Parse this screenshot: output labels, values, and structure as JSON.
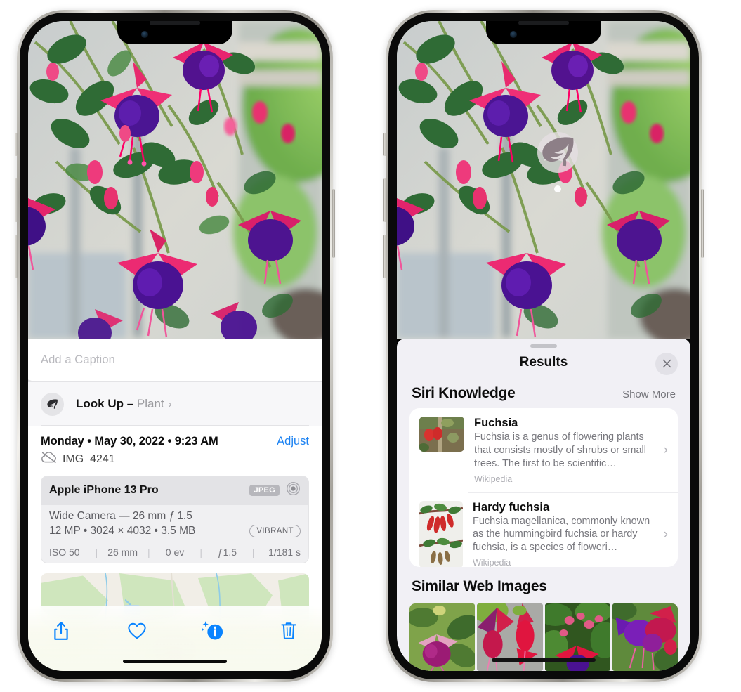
{
  "left_phone": {
    "caption": {
      "placeholder": "Add a Caption",
      "value": ""
    },
    "look_up": {
      "label": "Look Up",
      "dash": " – ",
      "subject": "Plant",
      "chevron": "›",
      "icon": "leaf-icon"
    },
    "info": {
      "date": "Monday • May 30, 2022 • 9:23 AM",
      "adjust_label": "Adjust",
      "filename": "IMG_4241",
      "cloud_icon": "icloud-slash-icon"
    },
    "exif": {
      "device": "Apple iPhone 13 Pro",
      "format_chip": "JPEG",
      "lens_icon": "aperture-icon",
      "lens_line": "Wide Camera — 26 mm ƒ 1.5",
      "specs_line": "12 MP • 3024 × 4032 • 3.5 MB",
      "style_chip": "VIBRANT",
      "settings": [
        "ISO 50",
        "26 mm",
        "0 ev",
        "ƒ1.5",
        "1/181 s"
      ],
      "separator": "|"
    },
    "toolbar": {
      "share_label": "Share",
      "favorite_label": "Favorite",
      "info_label": "Info",
      "delete_label": "Delete"
    }
  },
  "right_phone": {
    "badge": {
      "icon": "leaf-icon",
      "name": "visual-look-up-badge"
    },
    "sheet": {
      "title": "Results",
      "close_label": "Close"
    },
    "siri_knowledge": {
      "title": "Siri Knowledge",
      "show_more": "Show More",
      "items": [
        {
          "title": "Fuchsia",
          "description": "Fuchsia is a genus of flowering plants that consists mostly of shrubs or small trees. The first to be scientific…",
          "source": "Wikipedia",
          "chevron": "›"
        },
        {
          "title": "Hardy fuchsia",
          "description": "Fuchsia magellanica, commonly known as the hummingbird fuchsia or hardy fuchsia, is a species of floweri…",
          "source": "Wikipedia",
          "chevron": "›"
        }
      ]
    },
    "similar_web_images": {
      "title": "Similar Web Images",
      "count": 4
    }
  },
  "colors": {
    "accent_blue": "#1c82f2",
    "sheet_bg": "#f1f0f5",
    "card_bg": "#ffffff",
    "secondary_text": "#78787e",
    "exif_bg": "#f0f0f2"
  }
}
